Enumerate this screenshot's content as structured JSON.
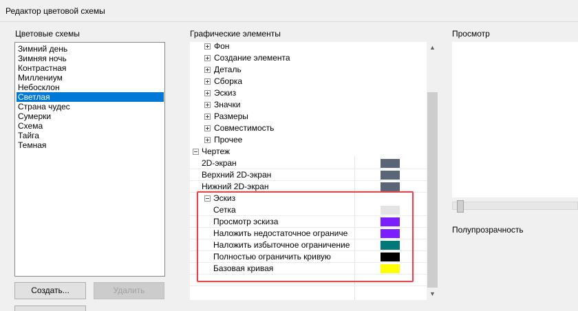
{
  "window": {
    "title": "Редактор цветовой схемы"
  },
  "schemes": {
    "label": "Цветовые схемы",
    "items": [
      {
        "label": "Зимний день"
      },
      {
        "label": "Зимняя ночь"
      },
      {
        "label": "Контрастная"
      },
      {
        "label": "Миллениум"
      },
      {
        "label": "Небосклон"
      },
      {
        "label": "Светлая",
        "selected": true
      },
      {
        "label": "Страна чудес"
      },
      {
        "label": "Сумерки"
      },
      {
        "label": "Схема"
      },
      {
        "label": "Тайга"
      },
      {
        "label": "Темная"
      }
    ],
    "create_label": "Создать...",
    "delete_label": "Удалить"
  },
  "elements": {
    "label": "Графические элементы",
    "groups": [
      {
        "label": "Фон",
        "expanded": false
      },
      {
        "label": "Создание элемента",
        "expanded": false
      },
      {
        "label": "Деталь",
        "expanded": false
      },
      {
        "label": "Сборка",
        "expanded": false
      },
      {
        "label": "Эскиз",
        "expanded": false
      },
      {
        "label": "Значки",
        "expanded": false
      },
      {
        "label": "Размеры",
        "expanded": false
      },
      {
        "label": "Совместимость",
        "expanded": false
      },
      {
        "label": "Прочее",
        "expanded": false
      }
    ],
    "drawing": {
      "label": "Чертеж",
      "expanded": true,
      "items": [
        {
          "label": "2D-экран",
          "color": "#5a6678"
        },
        {
          "label": "Верхний 2D-экран",
          "color": "#5a6678"
        },
        {
          "label": "Нижний 2D-экран",
          "color": "#5a6678"
        }
      ],
      "sketch": {
        "label": "Эскиз",
        "expanded": true,
        "items": [
          {
            "label": "Сетка",
            "color": "#e3e3e3"
          },
          {
            "label": "Просмотр эскиза",
            "color": "#7b1fff"
          },
          {
            "label": "Наложить недостаточное ограниче",
            "color": "#7b1fff"
          },
          {
            "label": "Наложить избыточное ограничение",
            "color": "#007878"
          },
          {
            "label": "Полностью ограничить кривую",
            "color": "#000000"
          },
          {
            "label": "Базовая кривая",
            "color": "#ffff00"
          }
        ]
      }
    }
  },
  "preview": {
    "label": "Просмотр"
  },
  "transparency": {
    "label": "Полупрозрачность",
    "value": 0
  },
  "icons": {
    "scroll_up": "▲",
    "scroll_down": "▼"
  }
}
